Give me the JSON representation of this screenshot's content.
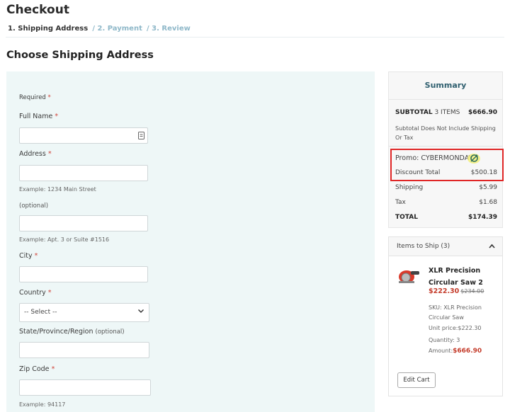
{
  "header": {
    "title": "Checkout",
    "steps": [
      "1. Shipping Address",
      "/ 2. Payment",
      "/ 3. Review"
    ]
  },
  "section_title": "Choose Shipping Address",
  "form": {
    "required_note": "Required",
    "required_mark": "*",
    "full_name": {
      "label": "Full Name",
      "value": ""
    },
    "address": {
      "label": "Address",
      "value": "",
      "hint": "Example: 1234 Main Street"
    },
    "address2": {
      "label": "(optional)",
      "value": "",
      "hint": "Example: Apt. 3 or Suite #1516"
    },
    "city": {
      "label": "City",
      "value": ""
    },
    "country": {
      "label": "Country",
      "selected": "-- Select --"
    },
    "state": {
      "label": "State/Province/Region",
      "optional": "(optional)",
      "value": ""
    },
    "zip": {
      "label": "Zip Code",
      "value": "",
      "hint": "Example: 94117"
    }
  },
  "summary": {
    "title": "Summary",
    "subtotal_label": "SUBTOTAL",
    "subtotal_items": "3 ITEMS",
    "subtotal_value": "$666.90",
    "note": "Subtotal Does Not Include Shipping Or Tax",
    "promo_label": "Promo:",
    "promo_code": "CYBERMONDAY",
    "discount_label": "Discount Total",
    "discount_value": "$500.18",
    "shipping_label": "Shipping",
    "shipping_value": "$5.99",
    "tax_label": "Tax",
    "tax_value": "$1.68",
    "total_label": "TOTAL",
    "total_value": "$174.39",
    "highlight_color": "#e02626"
  },
  "items_panel": {
    "title": "Items to Ship (3)",
    "product": {
      "name": "XLR Precision Circular Saw 2",
      "price": "$222.30",
      "old_price": "$234.00",
      "sku": "SKU: XLR Precision Circular Saw",
      "unit_price": "Unit price:$222.30",
      "quantity": "Quantity: 3",
      "amount_label": "Amount:",
      "amount_value": "$666.90"
    },
    "edit_cart_label": "Edit Cart"
  },
  "colors": {
    "form_bg": "#eef7f7",
    "accent_muted": "#8fb8c9",
    "price_red": "#c43b2a"
  },
  "icons": [
    "autofill-contact-icon",
    "chevron-down-icon",
    "refresh-icon",
    "chevron-up-icon",
    "circular-saw-image"
  ]
}
